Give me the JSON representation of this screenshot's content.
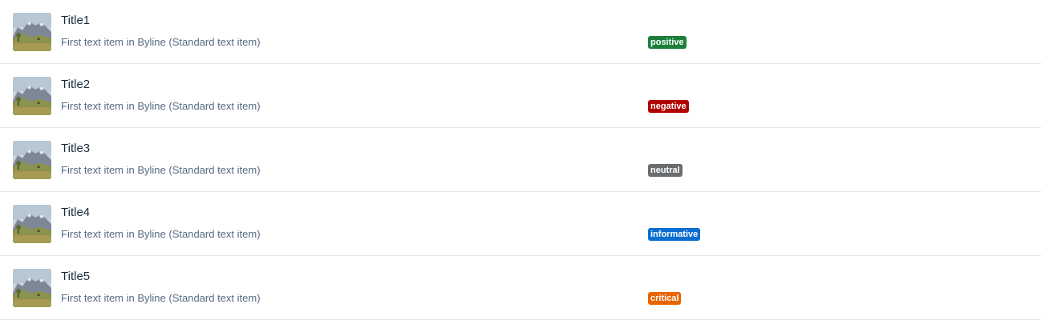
{
  "colors": {
    "positive": "#188918",
    "negative": "#bb0000",
    "neutral": "#5b6770",
    "informative": "#0a6ed1",
    "critical": "#e26e00"
  },
  "items": [
    {
      "icon": "landscape-image-icon",
      "title": "Title1",
      "byline": "First text item in Byline (Standard text item)",
      "status": "positive",
      "status_color": "#1b7f3a"
    },
    {
      "icon": "landscape-image-icon",
      "title": "Title2",
      "byline": "First text item in Byline (Standard text item)",
      "status": "negative",
      "status_color": "#b00000"
    },
    {
      "icon": "landscape-image-icon",
      "title": "Title3",
      "byline": "First text item in Byline (Standard text item)",
      "status": "neutral",
      "status_color": "#6a6d70"
    },
    {
      "icon": "landscape-image-icon",
      "title": "Title4",
      "byline": "First text item in Byline (Standard text item)",
      "status": "informative",
      "status_color": "#0a6ed1"
    },
    {
      "icon": "landscape-image-icon",
      "title": "Title5",
      "byline": "First text item in Byline (Standard text item)",
      "status": "critical",
      "status_color": "#e76500"
    }
  ]
}
